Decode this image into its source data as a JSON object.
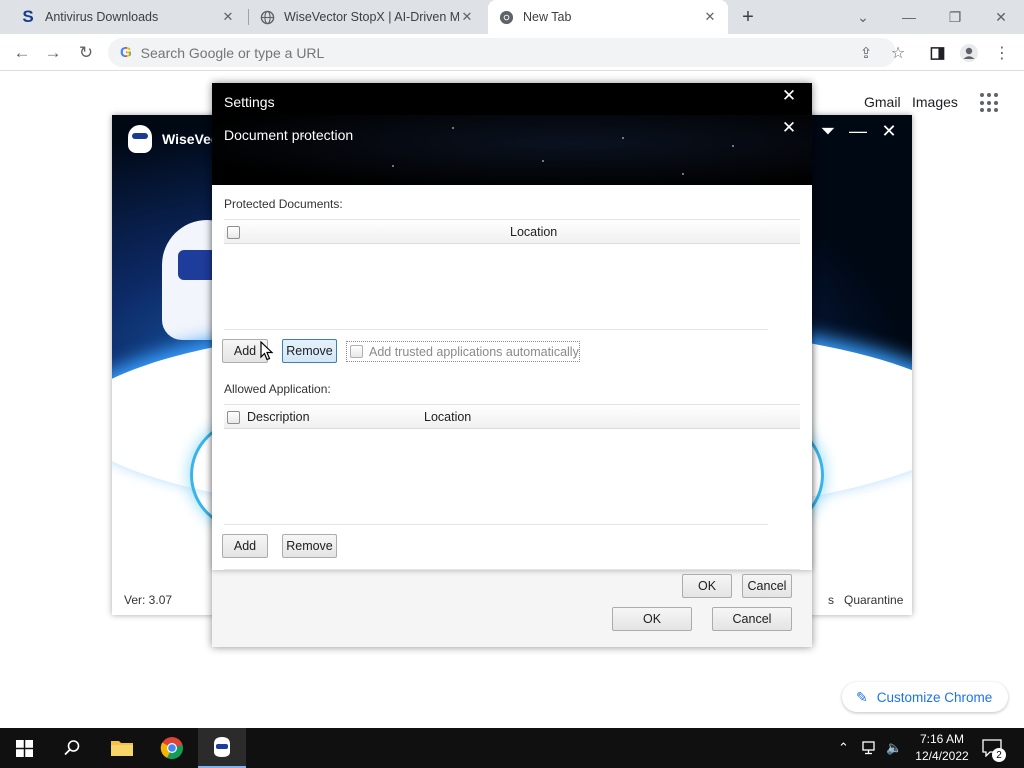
{
  "browser": {
    "tabs": [
      {
        "title": "Antivirus Downloads",
        "favicon": "S"
      },
      {
        "title": "WiseVector StopX | AI-Driven Ma",
        "favicon": "globe-icon"
      },
      {
        "title": "New Tab",
        "favicon": "chrome-icon"
      }
    ],
    "new_tab_symbol": "+",
    "omnibox_placeholder": "Search Google or type a URL",
    "google_g": "G"
  },
  "ntp": {
    "gmail": "Gmail",
    "images": "Images",
    "customize": "Customize Chrome"
  },
  "wisevector": {
    "brand": "WiseVec",
    "version": "Ver: 3.07",
    "quarantine_fragment": "s",
    "quarantine": "Quarantine"
  },
  "settings": {
    "title": "Settings",
    "ok": "OK",
    "cancel": "Cancel"
  },
  "doc_protection": {
    "title": "Document protection",
    "protected_label": "Protected Documents:",
    "protected_columns": [
      "Location"
    ],
    "add": "Add",
    "remove": "Remove",
    "auto_trust_label": "Add trusted applications automatically",
    "auto_trust_checked": false,
    "allowed_label": "Allowed Application:",
    "allowed_columns": [
      "Description",
      "Location"
    ],
    "add2": "Add",
    "remove2": "Remove",
    "ok": "OK",
    "cancel": "Cancel"
  },
  "taskbar": {
    "time": "7:16 AM",
    "date": "12/4/2022",
    "notification_count": "2"
  }
}
